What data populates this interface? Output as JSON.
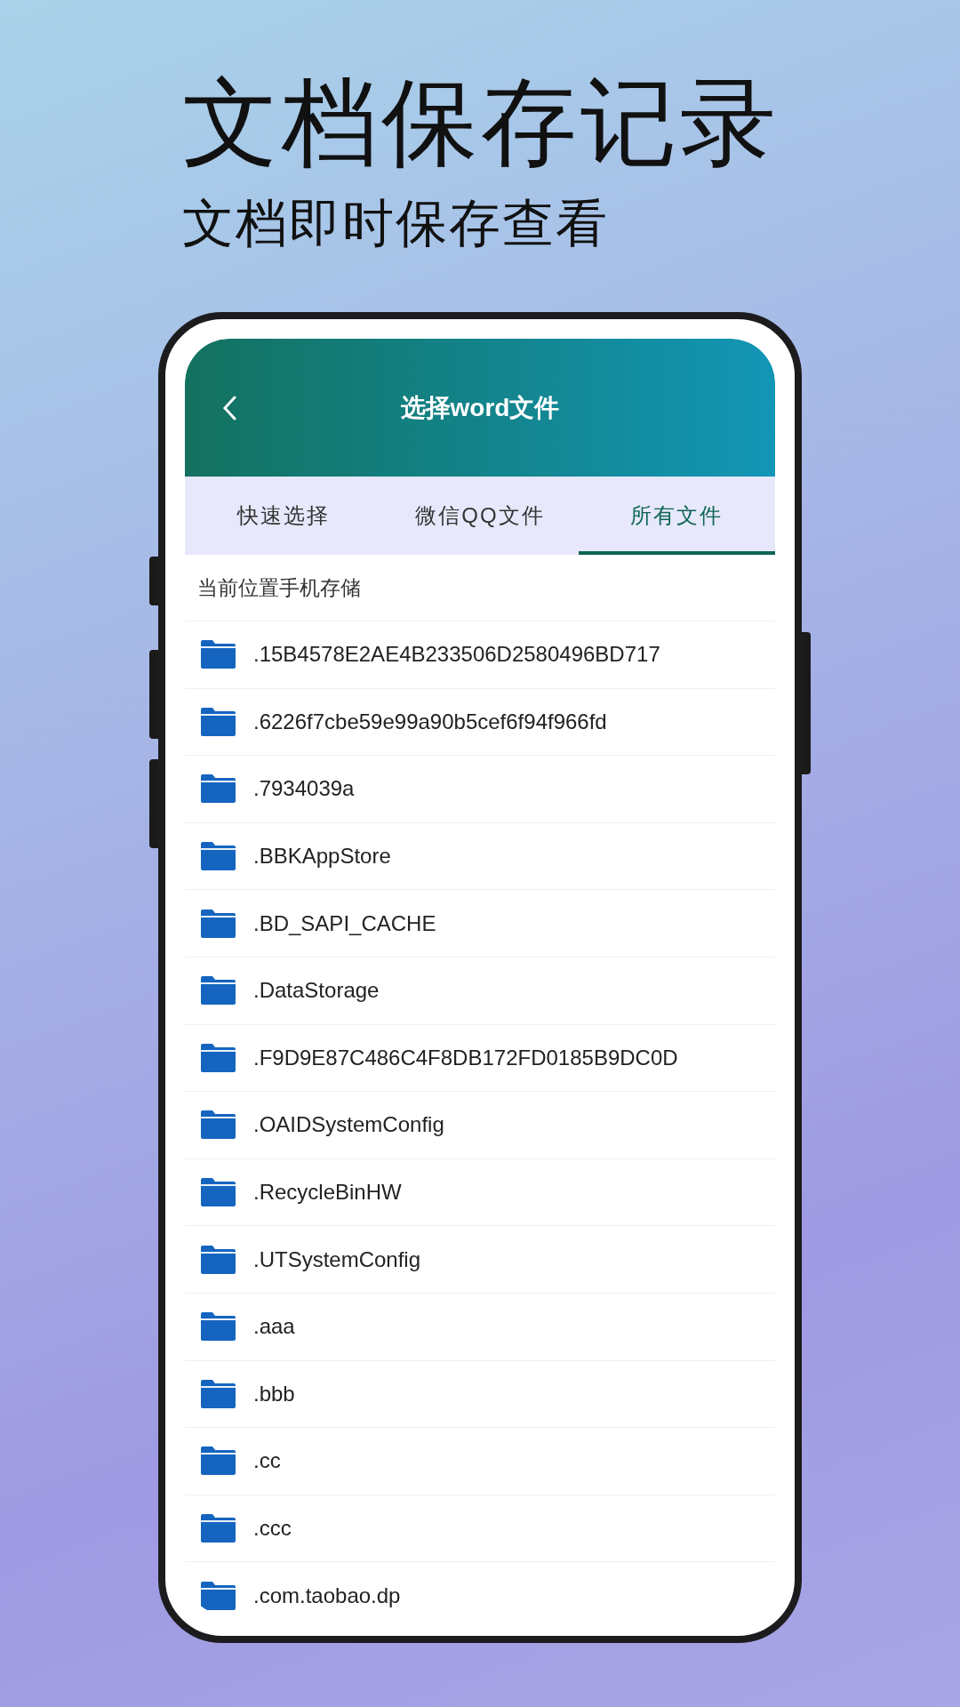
{
  "headline": "文档保存记录",
  "subheadline": "文档即时保存查看",
  "header": {
    "title": "选择word文件"
  },
  "tabs": [
    {
      "label": "快速选择",
      "selected": false
    },
    {
      "label": "微信QQ文件",
      "selected": false
    },
    {
      "label": "所有文件",
      "selected": true
    }
  ],
  "location": "当前位置手机存储",
  "folders": [
    ".15B4578E2AE4B233506D2580496BD717",
    ".6226f7cbe59e99a90b5cef6f94f966fd",
    ".7934039a",
    ".BBKAppStore",
    ".BD_SAPI_CACHE",
    ".DataStorage",
    ".F9D9E87C486C4F8DB172FD0185B9DC0D",
    ".OAIDSystemConfig",
    ".RecycleBinHW",
    ".UTSystemConfig",
    ".aaa",
    ".bbb",
    ".cc",
    ".ccc",
    ".com.taobao.dp"
  ]
}
